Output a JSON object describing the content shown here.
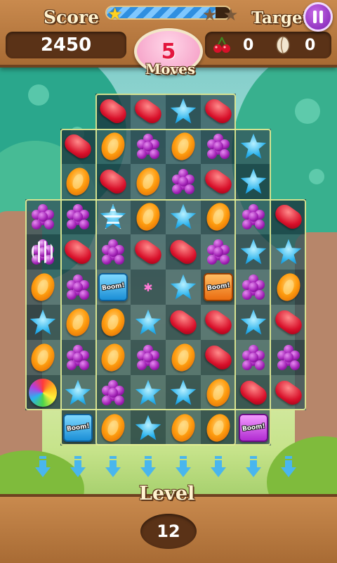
{
  "header": {
    "score_label": "Score",
    "score_value": "2450",
    "target_label": "Target",
    "moves_value": "5",
    "moves_label": "Moves",
    "progress_fraction": 0.88,
    "stars_earned": 1,
    "stars_total": 3,
    "targets": [
      {
        "icon": "cherry-icon",
        "count": "0"
      },
      {
        "icon": "nut-icon",
        "count": "0"
      }
    ]
  },
  "footer": {
    "level_label": "Level",
    "level_value": "12"
  },
  "board": {
    "columns": 8,
    "rows": 10,
    "legend": {
      "R": "red-jelly-bean",
      "O": "orange-lozenge",
      "P": "purple-grape-cluster",
      "B": "blue-star",
      "BS": "blue-star-striped",
      "PS": "purple-grape-striped",
      "BB": "blue-wrapped-bomb",
      "OB": "orange-wrapped-bomb",
      "PB": "purple-wrapped-bomb",
      "CB": "rainbow-color-bomb",
      "E": "empty-cell",
      "X": "no-cell"
    },
    "bomb_text": "Boom!",
    "cells": [
      [
        "X",
        "X",
        "R",
        "R",
        "B",
        "R",
        "X",
        "X"
      ],
      [
        "X",
        "R",
        "O",
        "P",
        "O",
        "P",
        "B",
        "X"
      ],
      [
        "X",
        "O",
        "R",
        "O",
        "P",
        "R",
        "B",
        "X"
      ],
      [
        "P",
        "P",
        "BS",
        "O",
        "B",
        "O",
        "P",
        "R"
      ],
      [
        "PS",
        "R",
        "P",
        "R",
        "R",
        "P",
        "B",
        "B"
      ],
      [
        "O",
        "P",
        "BB",
        "E",
        "B",
        "OB",
        "P",
        "O"
      ],
      [
        "B",
        "O",
        "O",
        "B",
        "R",
        "R",
        "B",
        "R"
      ],
      [
        "O",
        "P",
        "O",
        "P",
        "O",
        "R",
        "P",
        "P"
      ],
      [
        "CB",
        "B",
        "P",
        "B",
        "B",
        "O",
        "R",
        "R"
      ],
      [
        "X",
        "BB",
        "O",
        "B",
        "O",
        "O",
        "PB",
        "X"
      ]
    ]
  },
  "spawn_arrows": 8,
  "colors": {
    "wood": "#b8783f",
    "progress_blue": "#2f8fe0",
    "moves_text": "#e3163e",
    "pause_purple": "#9b2fcf"
  }
}
